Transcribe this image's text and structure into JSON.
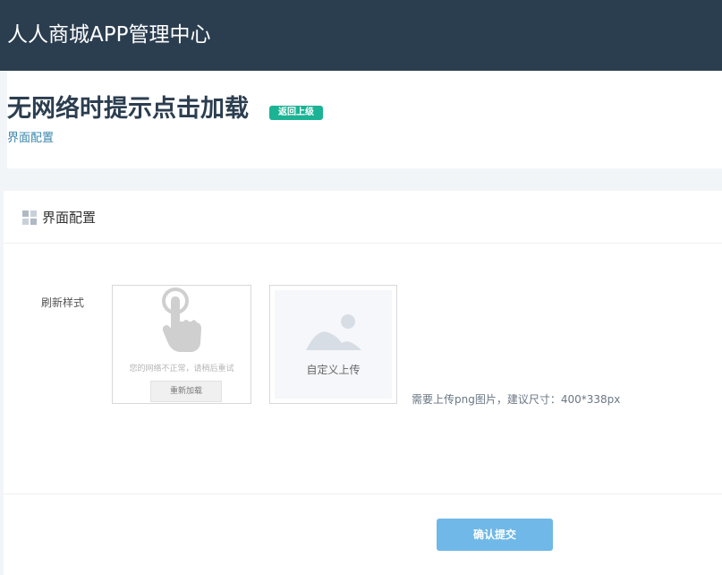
{
  "app": {
    "title": "人人商城APP管理中心"
  },
  "header": {
    "title": "无网络时提示点击加载",
    "back_label": "返回上级",
    "breadcrumb": "界面配置"
  },
  "card": {
    "title": "界面配置",
    "icon": "grid-icon"
  },
  "form": {
    "refresh_style_label": "刷新样式",
    "default_option": {
      "icon": "touch-hand-icon",
      "message": "您的网络不正常，请稍后重试",
      "button_label": "重新加载"
    },
    "custom_option": {
      "icon": "image-icon",
      "label": "自定义上传"
    },
    "hint": "需要上传png图片，建议尺寸：400*338px"
  },
  "footer": {
    "submit_label": "确认提交"
  },
  "colors": {
    "topbar": "#2b3e50",
    "badge": "#1bb394",
    "submit": "#6fb8e8",
    "link": "#3a87ad"
  }
}
